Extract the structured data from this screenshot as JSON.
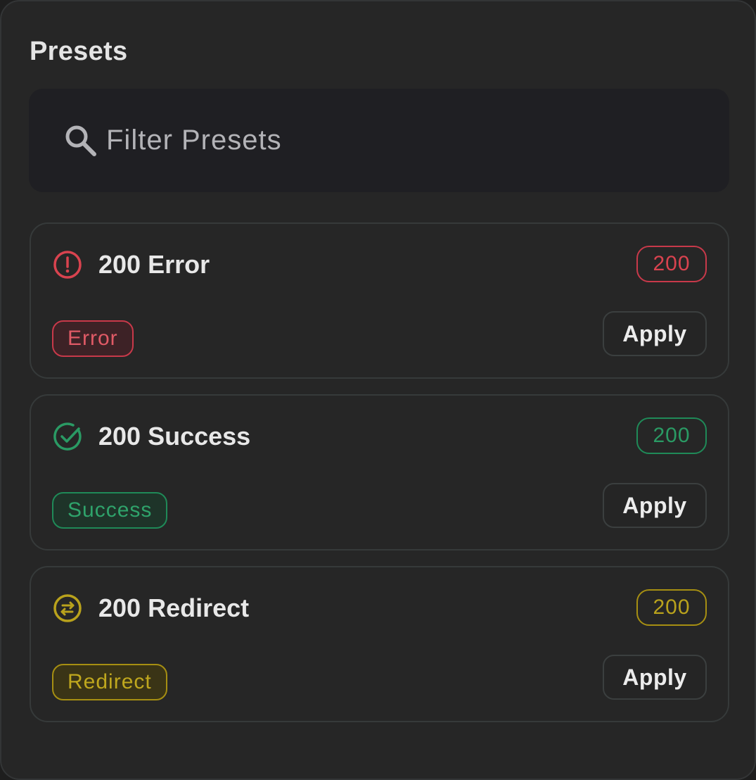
{
  "panel": {
    "title": "Presets"
  },
  "search": {
    "placeholder": "Filter Presets",
    "value": "",
    "icon": "search-icon"
  },
  "colors": {
    "error": "#d9434f",
    "success": "#2a9a64",
    "redirect": "#b9a21c"
  },
  "presets": [
    {
      "title": "200 Error",
      "code": "200",
      "tag": "Error",
      "icon": "alert-circle-icon",
      "apply_label": "Apply"
    },
    {
      "title": "200 Success",
      "code": "200",
      "tag": "Success",
      "icon": "check-circle-icon",
      "apply_label": "Apply"
    },
    {
      "title": "200 Redirect",
      "code": "200",
      "tag": "Redirect",
      "icon": "redirect-arrows-icon",
      "apply_label": "Apply"
    }
  ]
}
